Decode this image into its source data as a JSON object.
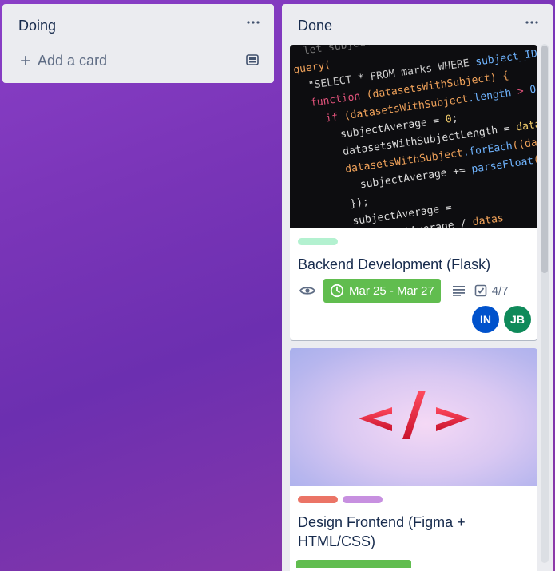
{
  "lists": [
    {
      "title": "Doing",
      "add_card_label": "Add a card"
    },
    {
      "title": "Done",
      "cards": [
        {
          "cover": "code-screenshot",
          "labels": [
            "#b3f1d0"
          ],
          "title": "Backend Development (Flask)",
          "due": "Mar 25 - Mar 27",
          "checklist": "4/7",
          "members": [
            "IN",
            "JB"
          ],
          "icons": [
            "eye-icon",
            "clock-icon",
            "description-icon",
            "checklist-icon"
          ]
        },
        {
          "cover": "html-tag-graphic",
          "labels": [
            "#eb7466",
            "#c790e0"
          ],
          "title": "Design Frontend (Figma + HTML/CSS)"
        }
      ]
    }
  ],
  "colors": {
    "due_complete": "#61bd4f",
    "avatar_in": "#0052cc",
    "avatar_jb": "#0f8a5a"
  }
}
